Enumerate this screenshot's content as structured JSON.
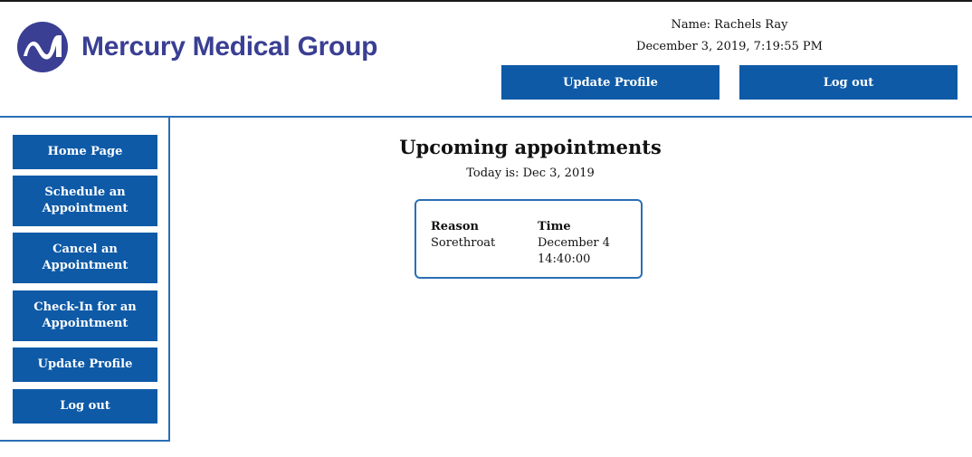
{
  "brand": {
    "name": "Mercury Medical Group",
    "logo_icon": "mercury-m-logo-icon",
    "color": "#3a3f93"
  },
  "header": {
    "name_line": "Name: Rachels Ray",
    "datetime": "December 3, 2019, 7:19:55 PM",
    "update_profile_label": "Update Profile",
    "logout_label": "Log out"
  },
  "sidebar": {
    "items": [
      {
        "label": "Home Page"
      },
      {
        "label": "Schedule an Appointment"
      },
      {
        "label": "Cancel an Appointment"
      },
      {
        "label": "Check-In for an Appointment"
      },
      {
        "label": "Update Profile"
      },
      {
        "label": "Log out"
      }
    ]
  },
  "main": {
    "title": "Upcoming appointments",
    "today": "Today is: Dec 3, 2019",
    "appointment": {
      "reason_header": "Reason",
      "time_header": "Time",
      "reason": "Sorethroat",
      "time_date": "December 4",
      "time_clock": "14:40:00"
    }
  },
  "colors": {
    "button": "#0e5aa7",
    "border": "#2a6fb5"
  }
}
